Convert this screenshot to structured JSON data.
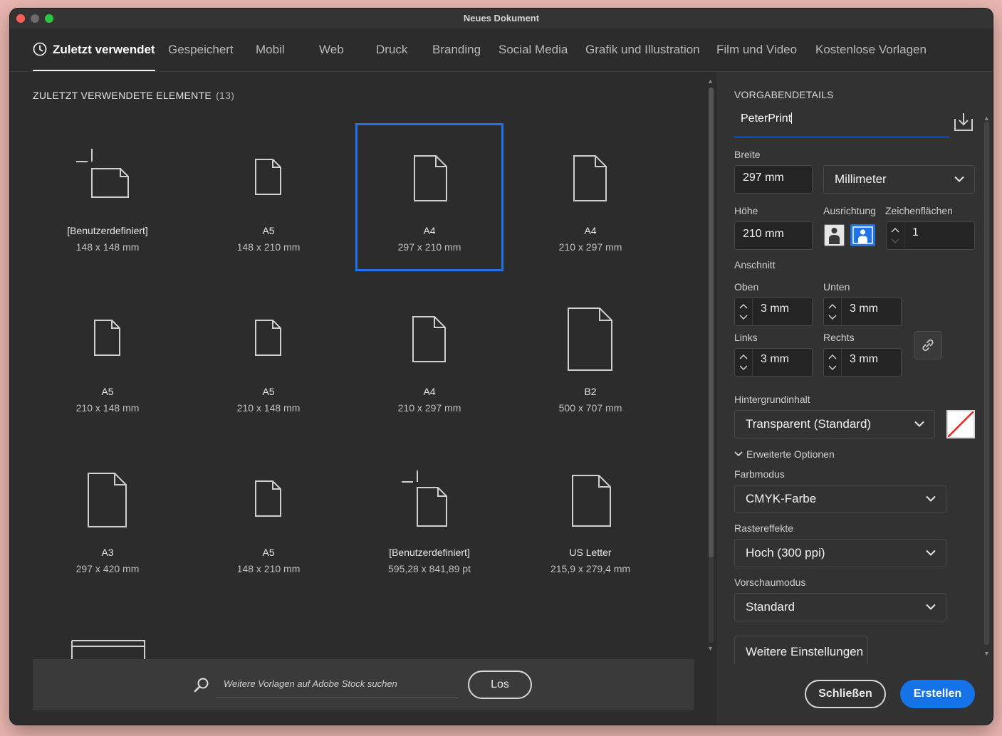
{
  "window": {
    "title": "Neues Dokument"
  },
  "tabs": [
    {
      "label": "Zuletzt verwendet",
      "active": true,
      "icon": "clock-icon"
    },
    {
      "label": "Gespeichert"
    },
    {
      "label": "Mobil"
    },
    {
      "label": "Web"
    },
    {
      "label": "Druck"
    },
    {
      "label": "Branding"
    },
    {
      "label": "Social Media"
    },
    {
      "label": "Grafik und Illustration"
    },
    {
      "label": "Film und Video"
    },
    {
      "label": "Kostenlose Vorlagen"
    }
  ],
  "recent": {
    "title": "ZULETZT VERWENDETE ELEMENTE",
    "count": "(13)",
    "items": [
      {
        "name": "[Benutzerdefiniert]",
        "size": "148 x 148 mm",
        "icon": "custom-document-icon"
      },
      {
        "name": "A5",
        "size": "148 x 210 mm",
        "icon": "document-icon"
      },
      {
        "name": "A4",
        "size": "297 x 210 mm",
        "icon": "document-icon",
        "selected": true
      },
      {
        "name": "A4",
        "size": "210 x 297 mm",
        "icon": "document-icon"
      },
      {
        "name": "A5",
        "size": "210 x 148 mm",
        "icon": "document-icon"
      },
      {
        "name": "A5",
        "size": "210 x 148 mm",
        "icon": "document-icon"
      },
      {
        "name": "A4",
        "size": "210 x 297 mm",
        "icon": "document-icon"
      },
      {
        "name": "B2",
        "size": "500 x 707 mm",
        "icon": "document-icon"
      },
      {
        "name": "A3",
        "size": "297 x 420 mm",
        "icon": "document-icon"
      },
      {
        "name": "A5",
        "size": "148 x 210 mm",
        "icon": "document-icon"
      },
      {
        "name": "[Benutzerdefiniert]",
        "size": "595,28 x 841,89 pt",
        "icon": "custom-document-icon"
      },
      {
        "name": "US Letter",
        "size": "215,9 x 279,4 mm",
        "icon": "document-icon"
      }
    ]
  },
  "stock_search": {
    "placeholder": "Weitere Vorlagen auf Adobe Stock suchen",
    "button": "Los"
  },
  "details": {
    "heading": "VORGABENDETAILS",
    "preset_name": "PeterPrint",
    "width_label": "Breite",
    "width_value": "297 mm",
    "unit": "Millimeter",
    "height_label": "Höhe",
    "height_value": "210 mm",
    "orientation_label": "Ausrichtung",
    "orientation_selected": "landscape",
    "artboards_label": "Zeichenflächen",
    "artboards_value": "1",
    "bleed_label": "Anschnitt",
    "top_label": "Oben",
    "top_value": "3 mm",
    "bottom_label": "Unten",
    "bottom_value": "3 mm",
    "left_label": "Links",
    "left_value": "3 mm",
    "right_label": "Rechts",
    "right_value": "3 mm",
    "background_label": "Hintergrundinhalt",
    "background_value": "Transparent (Standard)",
    "advanced_label": "Erweiterte Optionen",
    "color_mode_label": "Farbmodus",
    "color_mode_value": "CMYK-Farbe",
    "raster_label": "Rastereffekte",
    "raster_value": "Hoch (300 ppi)",
    "preview_label": "Vorschaumodus",
    "preview_value": "Standard",
    "more_settings": "Weitere Einstellungen"
  },
  "footer": {
    "close": "Schließen",
    "create": "Erstellen"
  },
  "colors": {
    "accent": "#1473e6",
    "window_bg": "#2c2c2c",
    "panel_bg": "#323232"
  }
}
